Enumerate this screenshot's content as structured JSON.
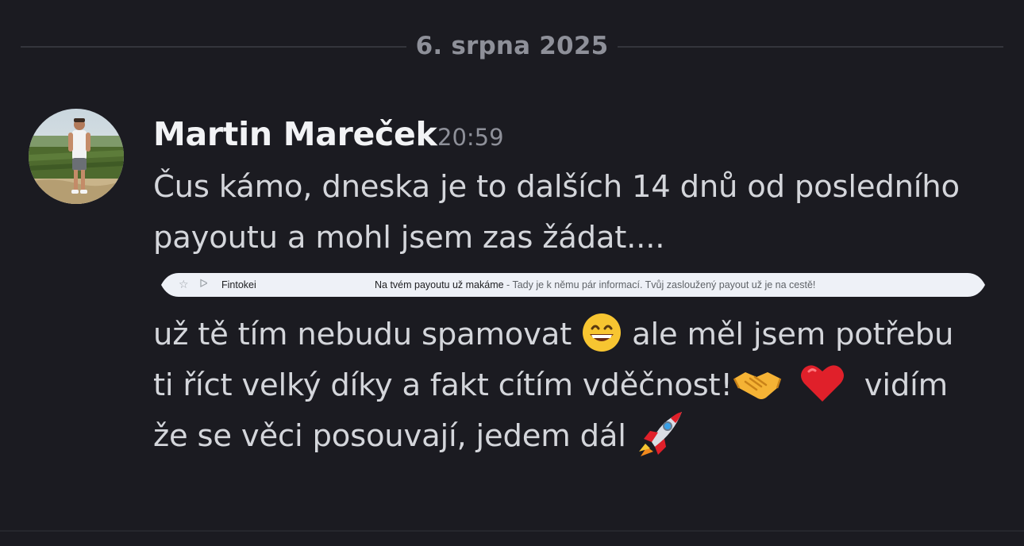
{
  "divider": {
    "date": "6. srpna 2025"
  },
  "message": {
    "author": "Martin Mareček",
    "time": "20:59",
    "line1": "Čus kámo, dneska je to dalších 14 dnů od posledního",
    "line2": "payoutu a mohl jsem zas žádat....",
    "line3a": "už tě tím nebudu spamovat",
    "line3b": " ale měl jsem potřebu",
    "line4a": "ti říct velký díky a fakt cítím vděčnost!",
    "line4b": " vidím",
    "line5": "že se věci posouvají, jedem dál",
    "emojis": [
      "grinning-face-icon",
      "handshake-icon",
      "red-heart-icon",
      "rocket-icon"
    ]
  },
  "email_preview": {
    "sender": "Fintokei",
    "subject": "Na tvém payoutu už makáme",
    "separator": " - ",
    "snippet": "Tady je k němu pár informací. Tvůj zasloužený payout už je na cestě!"
  },
  "colors": {
    "background": "#1b1b21",
    "author": "#f2f3f5",
    "text": "#d4d6db",
    "muted": "#8e9099",
    "divider": "#34353c"
  }
}
